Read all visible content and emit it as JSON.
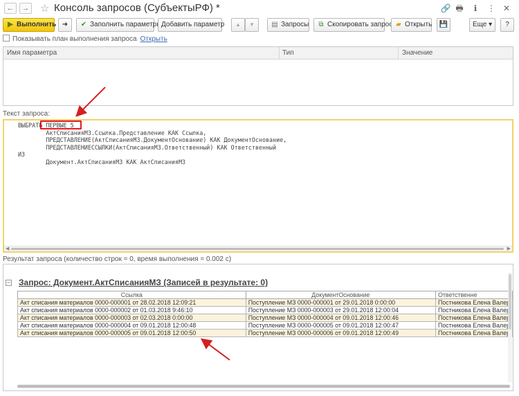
{
  "window": {
    "title": "Консоль запросов (СубъектыРФ) *",
    "back_glyph": "←",
    "forward_glyph": "→",
    "star_glyph": "☆",
    "right_icons": [
      "link-icon",
      "print-icon",
      "info-icon",
      "more-icon",
      "close-icon"
    ],
    "right_glyphs": [
      "🔗",
      "🖶",
      "ℹ",
      "⋮",
      "✕"
    ]
  },
  "toolbar": {
    "run_label": "Выполнить",
    "arrow_glyph": "➜",
    "fill_params_label": "Заполнить параметры",
    "add_param_label": "Добавить параметр",
    "up_glyph": "▲",
    "down_glyph": "▼",
    "queries_label": "Запросы",
    "copy_query_label": "Скопировать запрос",
    "open_label": "Открыть",
    "save_glyph": "💾",
    "more_label": "Еще ▾",
    "help_label": "?"
  },
  "show_plan": {
    "label": "Показывать план выполнения запроса",
    "link": "Открыть",
    "checked": false
  },
  "params_table": {
    "columns": [
      "Имя параметра",
      "Тип",
      "Значение"
    ]
  },
  "query": {
    "label": "Текст запроса:",
    "text": "ВЫБРАТЬ ПЕРВЫЕ 5\n\tАктСписанияМЗ.Ссылка.Представление КАК Ссылка,\n\tПРЕДСТАВЛЕНИЕ(АктСписанияМЗ.ДокументОснование) КАК ДокументОснование,\n\tПРЕДСТАВЛЕНИЕССЫЛКИ(АктСписанияМЗ.Ответственный) КАК Ответственный\nИЗ\n\tДокумент.АктСписанияМЗ КАК АктСписанияМЗ"
  },
  "result": {
    "label": "Результат запроса (количество строк = 0, время выполнения = 0.002 с)",
    "title": "Запрос: Документ.АктСписанияМЗ (Записей в результате: 0)",
    "collapse_glyph": "−",
    "columns": [
      "Ссылка",
      "ДокументОснование",
      "Ответственне"
    ],
    "rows": [
      [
        "Акт списания материалов 0000-000001 от 28.02.2018 12:09:21",
        "Поступление МЗ 0000-000001 от 29.01.2018 0:00:00",
        "Постникова Елена Валер"
      ],
      [
        "Акт списания материалов 0000-000002 от 01.03.2018 9:46:10",
        "Поступление МЗ 0000-000003 от 29.01.2018 12:00:04",
        "Постникова Елена Валер"
      ],
      [
        "Акт списания материалов 0000-000003 от 02.03.2018 0:00:00",
        "Поступление МЗ 0000-000004 от 09.01.2018 12:00:46",
        "Постникова Елена Валер"
      ],
      [
        "Акт списания материалов 0000-000004 от 09.01.2018 12:00:48",
        "Поступление МЗ 0000-000005 от 09.01.2018 12:00:47",
        "Постникова Елена Валер"
      ],
      [
        "Акт списания материалов 0000-000005 от 09.01.2018 12:00:50",
        "Поступление МЗ 0000-000006 от 09.01.2018 12:00:49",
        "Постникова Елена Валер"
      ]
    ]
  },
  "colors": {
    "highlight_box": "#e21c1c",
    "annotation_arrow": "#d42020",
    "run_button": "#f2c40f",
    "query_border": "#f0d36a",
    "row_alt": "#fbf3dc",
    "link": "#3b6fb6"
  }
}
